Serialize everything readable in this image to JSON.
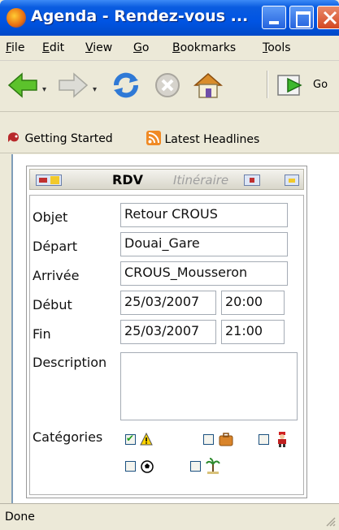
{
  "window": {
    "title": "Agenda - Rendez-vous ..."
  },
  "menu": [
    {
      "label": "File",
      "hot": "F",
      "rest": "ile"
    },
    {
      "label": "Edit",
      "hot": "E",
      "rest": "dit"
    },
    {
      "label": "View",
      "hot": "V",
      "rest": "iew"
    },
    {
      "label": "Go",
      "hot": "G",
      "rest": "o"
    },
    {
      "label": "Bookmarks",
      "hot": "B",
      "rest": "ookmarks"
    },
    {
      "label": "Tools",
      "hot": "T",
      "rest": "ools"
    }
  ],
  "toolbar": {
    "go_label": "Go"
  },
  "bookmarks": [
    {
      "label": "Getting Started",
      "icon": "getting-started-icon"
    },
    {
      "label": "Latest Headlines",
      "icon": "rss-feed-icon"
    }
  ],
  "panel": {
    "tab_rdv": "RDV",
    "tab_itineraire": "Itinéraire"
  },
  "form": {
    "objet_label": "Objet",
    "objet_value": "Retour CROUS",
    "depart_label": "Départ",
    "depart_value": "Douai_Gare",
    "arrivee_label": "Arrivée",
    "arrivee_value": "CROUS_Mousseron",
    "debut_label": "Début",
    "debut_date": "25/03/2007",
    "debut_time": "20:00",
    "fin_label": "Fin",
    "fin_date": "25/03/2007",
    "fin_time": "21:00",
    "description_label": "Description",
    "description_value": "",
    "categories_label": "Catégories",
    "categories": [
      {
        "icon": "warning-icon",
        "checked": true
      },
      {
        "icon": "briefcase-icon",
        "checked": false
      },
      {
        "icon": "person-icon",
        "checked": false
      },
      {
        "icon": "soccer-ball-icon",
        "checked": false
      },
      {
        "icon": "palm-tree-icon",
        "checked": false
      }
    ]
  },
  "status": {
    "text": "Done"
  },
  "colors": {
    "titlebar": "#0054e3",
    "chrome": "#ece9d8",
    "check": "#21a121"
  }
}
